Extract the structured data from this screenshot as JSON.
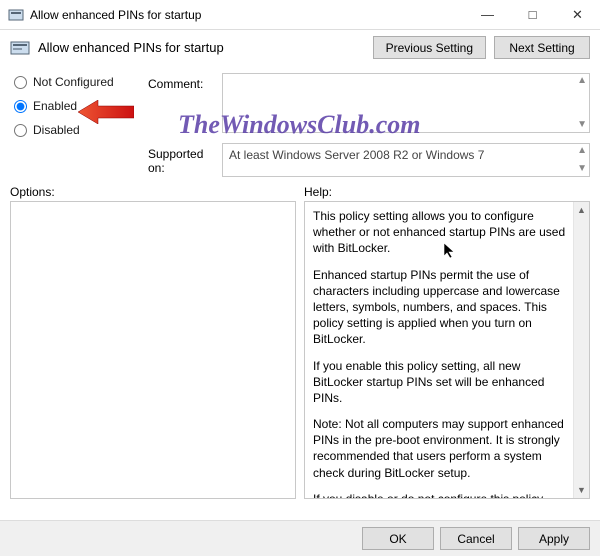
{
  "window": {
    "title": "Allow enhanced PINs for startup",
    "subtitle": "Allow enhanced PINs for startup"
  },
  "nav": {
    "previous": "Previous Setting",
    "next": "Next Setting"
  },
  "radios": {
    "not_configured": "Not Configured",
    "enabled": "Enabled",
    "disabled": "Disabled",
    "selected": "enabled"
  },
  "labels": {
    "comment": "Comment:",
    "supported": "Supported on:",
    "options": "Options:",
    "help": "Help:"
  },
  "comment_value": "",
  "supported_value": "At least Windows Server 2008 R2 or Windows 7",
  "help_paragraphs": [
    "This policy setting allows you to configure whether or not enhanced startup PINs are used with BitLocker.",
    "Enhanced startup PINs permit the use of characters including uppercase and lowercase letters, symbols, numbers, and spaces. This policy setting is applied when you turn on BitLocker.",
    "If you enable this policy setting, all new BitLocker startup PINs set will be enhanced PINs.",
    "Note:   Not all computers may support enhanced PINs in the pre-boot environment. It is strongly recommended that users perform a system check during BitLocker setup.",
    "If you disable or do not configure this policy setting, enhanced PINs will not be used."
  ],
  "footer": {
    "ok": "OK",
    "cancel": "Cancel",
    "apply": "Apply"
  },
  "watermark": "TheWindowsClub.com"
}
